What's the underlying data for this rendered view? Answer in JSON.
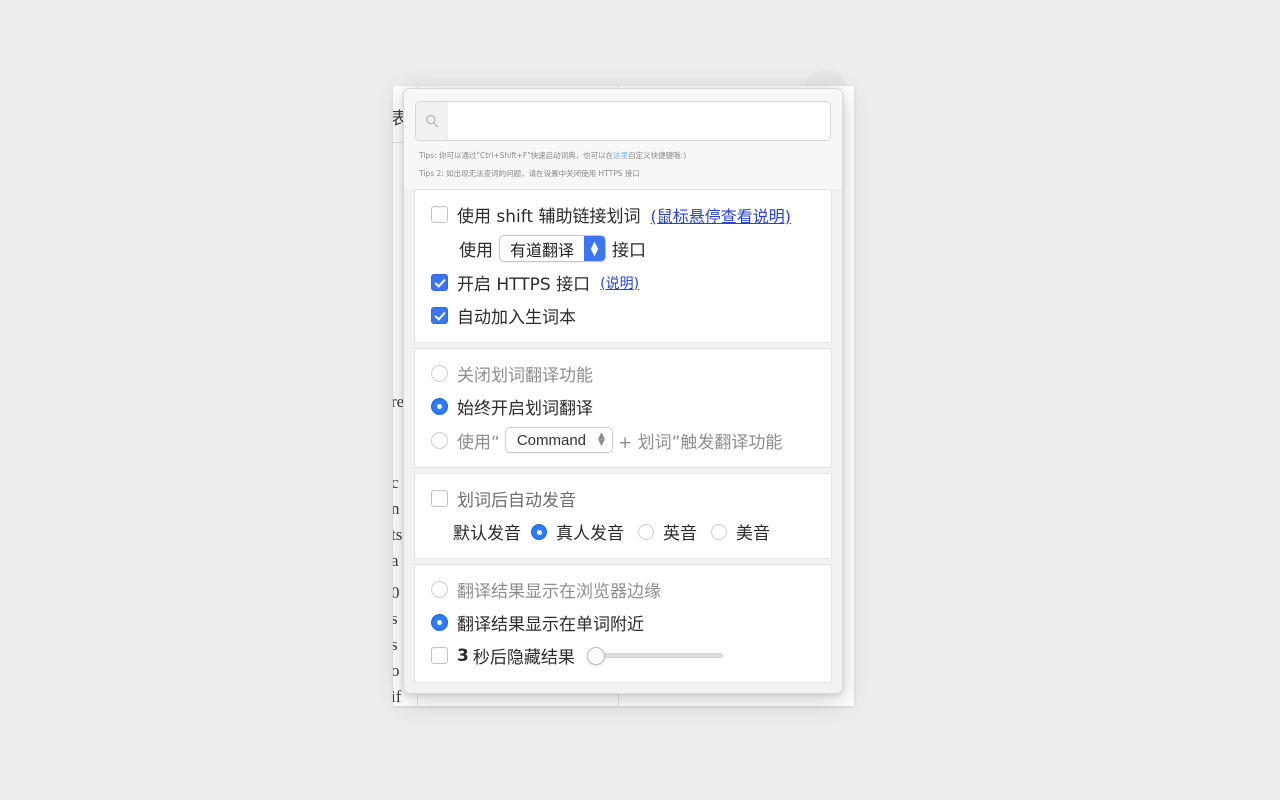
{
  "background_page": {
    "visible_text_fragments": [
      "表",
      "re",
      "c",
      "n",
      "ts",
      "a",
      "0",
      "s",
      "s",
      "o",
      "if"
    ]
  },
  "popup": {
    "search": {
      "value": "",
      "placeholder": "",
      "icon": "search-icon"
    },
    "tips": [
      "Tips: 你可以通过\"Ctrl+Shift+F\"快速启动词典，也可以在",
      "Tips 2: 如出现无法查词的问题，请在设置中关闭使用 HTTPS 接口"
    ],
    "tip1_link_text": "这里",
    "tip1_suffix": "自定义快捷键哦:)",
    "sections": {
      "general": {
        "shift_link_label": "使用 shift 辅助链接划词",
        "shift_link_hint": "(鼠标悬停查看说明)",
        "shift_link_checked": false,
        "api_prefix": "使用",
        "api_value": "有道翻译",
        "api_suffix": "接口",
        "https_label": "开启 HTTPS 接口",
        "https_hint": "(说明)",
        "https_checked": true,
        "wordbook_label": "自动加入生词本",
        "wordbook_checked": true
      },
      "trigger": {
        "option_off": "关闭划词翻译功能",
        "option_off_selected": false,
        "option_always": "始终开启划词翻译",
        "option_always_selected": true,
        "option_modifier_prefix": "使用“",
        "option_modifier_key": "Command",
        "option_modifier_suffix": "+ 划词”触发翻译功能",
        "option_modifier_selected": false
      },
      "pronunciation": {
        "auto_label": "划词后自动发音",
        "auto_checked": false,
        "default_label": "默认发音",
        "options": [
          {
            "label": "真人发音",
            "selected": true
          },
          {
            "label": "英音",
            "selected": false
          },
          {
            "label": "美音",
            "selected": false
          }
        ]
      },
      "display": {
        "option_edge": "翻译结果显示在浏览器边缘",
        "option_edge_selected": false,
        "option_near": "翻译结果显示在单词附近",
        "option_near_selected": true,
        "hide_number": "3",
        "hide_label": "秒后隐藏结果",
        "hide_checked": false,
        "slider_value": 0
      }
    }
  },
  "colors": {
    "accent_blue": "#3b76f0",
    "radio_blue": "#2b7cf6",
    "link_blue": "#2b43c8",
    "tip_link": "#7fb2e5",
    "desktop_bg": "#ececec"
  }
}
